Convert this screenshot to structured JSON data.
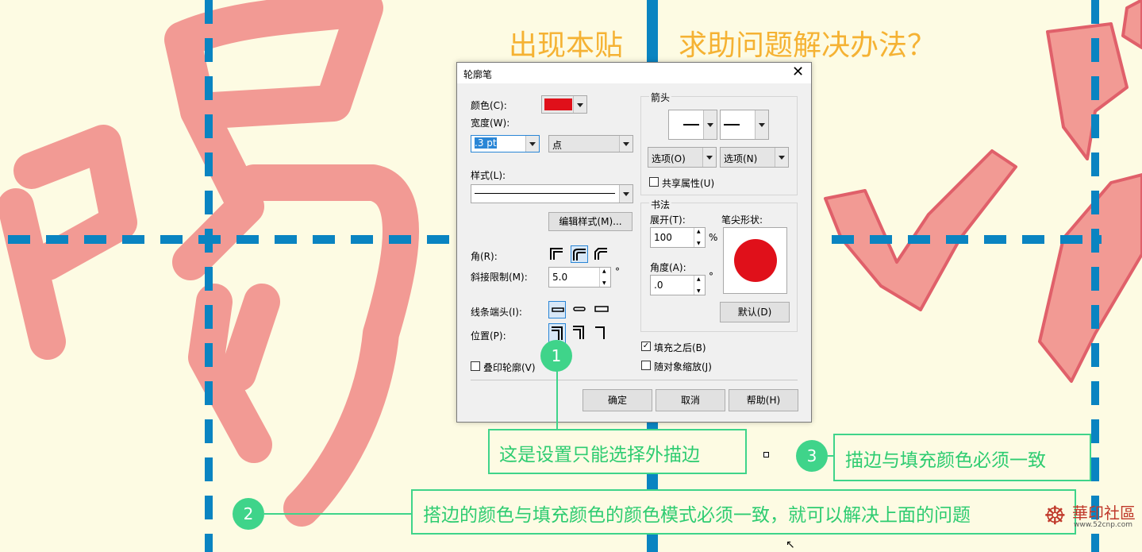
{
  "headline_left": "出现本贴",
  "headline_right": "求助问题解决办法？",
  "dialog": {
    "title": "轮廓笔",
    "color_label": "颜色(C):",
    "pen_color": "#e0101a",
    "width_label": "宽度(W):",
    "width_value": ".3 pt",
    "unit_value": "点",
    "style_label": "样式(L):",
    "edit_style_button": "编辑样式(M)...",
    "corner_label": "角(R):",
    "miter_label": "斜接限制(M):",
    "miter_value": "5.0",
    "degree_symbol": "°",
    "line_caps_label": "线条端头(I):",
    "position_label": "位置(P):",
    "overprint_label": "叠印轮廓(V)",
    "arrows_group": "箭头",
    "options_left": "选项(O)",
    "options_right": "选项(N)",
    "share_attributes": "共享属性(U)",
    "calligraphy_group": "书法",
    "stretch_label": "展开(T):",
    "stretch_value": "100",
    "percent": "%",
    "nib_shape_label": "笔尖形状:",
    "angle_label": "角度(A):",
    "angle_value": ".0",
    "default_button": "默认(D)",
    "behind_fill": "填充之后(B)",
    "behind_fill_checked": "✓",
    "scale_with_object": "随对象缩放(J)",
    "ok_button": "确定",
    "cancel_button": "取消",
    "help_button": "帮助(H)"
  },
  "annotations": {
    "badge1": "1",
    "badge2": "2",
    "badge3": "3",
    "callout1": "这是设置只能选择外描边",
    "callout2": "搭边的颜色与填充颜色的颜色模式必须一致，就可以解决上面的问题",
    "callout3": "描边与填充颜色必须一致"
  },
  "watermark": "華印社區",
  "watermark_url": "www.52cnp.com",
  "colors": {
    "accent_green": "#3fd48a",
    "guide_blue": "#0a84c1",
    "headline_orange": "#f5b233",
    "glyph_pink": "#f29a94"
  }
}
